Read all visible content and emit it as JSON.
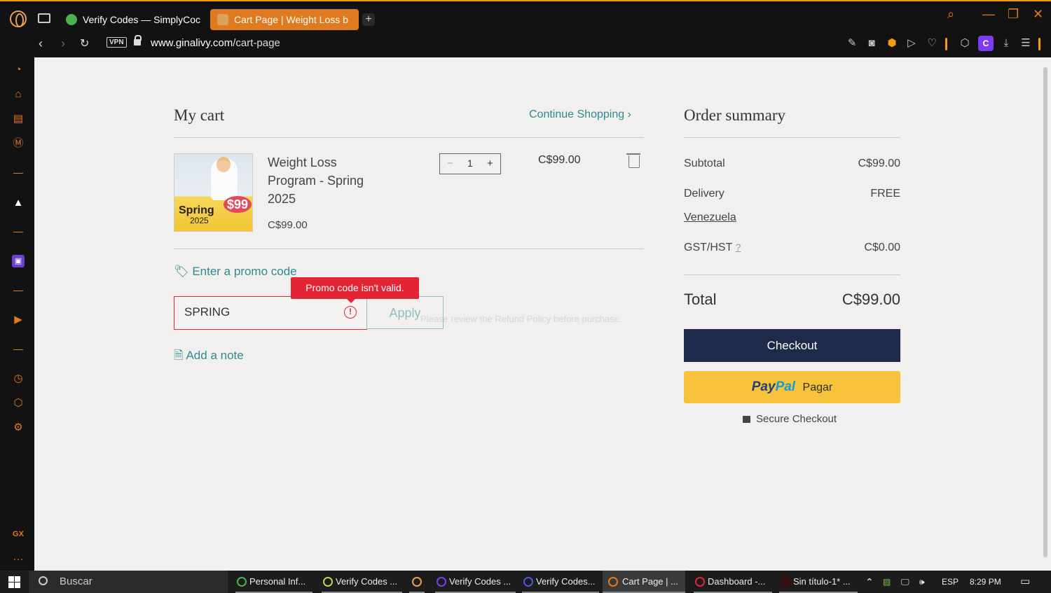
{
  "browser": {
    "tabs": [
      {
        "label": "Verify Codes — SimplyCoc",
        "active": false
      },
      {
        "label": "Cart Page | Weight Loss b",
        "active": true
      }
    ],
    "new_tab": "+",
    "url_host": "www.ginalivy.com",
    "url_path": "/cart-page",
    "vpn": "VPN",
    "profile": "C",
    "accent": "#e07a1f"
  },
  "sidebar": {
    "gx": "GX",
    "more": "···"
  },
  "cart": {
    "title": "My cart",
    "continue": "Continue Shopping ›",
    "item": {
      "name": "Weight Loss Program - Spring 2025",
      "price": "C$99.00",
      "quantity": "1",
      "line_total": "C$99.00",
      "image_text": {
        "spring": "Spring",
        "year": "2025",
        "price": "$99"
      }
    },
    "promo_link": "Enter a promo code",
    "promo_value": "SPRING",
    "promo_error": "Promo code isn't valid.",
    "apply": "Apply",
    "refund_note": "Please review the Refund Policy before purchase.",
    "add_note": "Add a note"
  },
  "summary": {
    "title": "Order summary",
    "subtotal_label": "Subtotal",
    "subtotal_value": "C$99.00",
    "delivery_label": "Delivery",
    "delivery_value": "FREE",
    "country": "Venezuela",
    "tax_label": "GST/HST",
    "tax_help": "?",
    "tax_value": "C$0.00",
    "total_label": "Total",
    "total_value": "C$99.00",
    "checkout": "Checkout",
    "paypal_pay": "Pay",
    "paypal_pal": "Pal",
    "paypal_action": "Pagar",
    "secure": "Secure Checkout"
  },
  "taskbar": {
    "search": "Buscar",
    "items": [
      "Personal Inf...",
      "Verify Codes ...",
      "Verify Codes ...",
      "Verify Codes...",
      "Cart Page | ...",
      "Dashboard -...",
      "Sin título-1* ..."
    ],
    "lang": "ESP",
    "time": "8:29 PM"
  }
}
